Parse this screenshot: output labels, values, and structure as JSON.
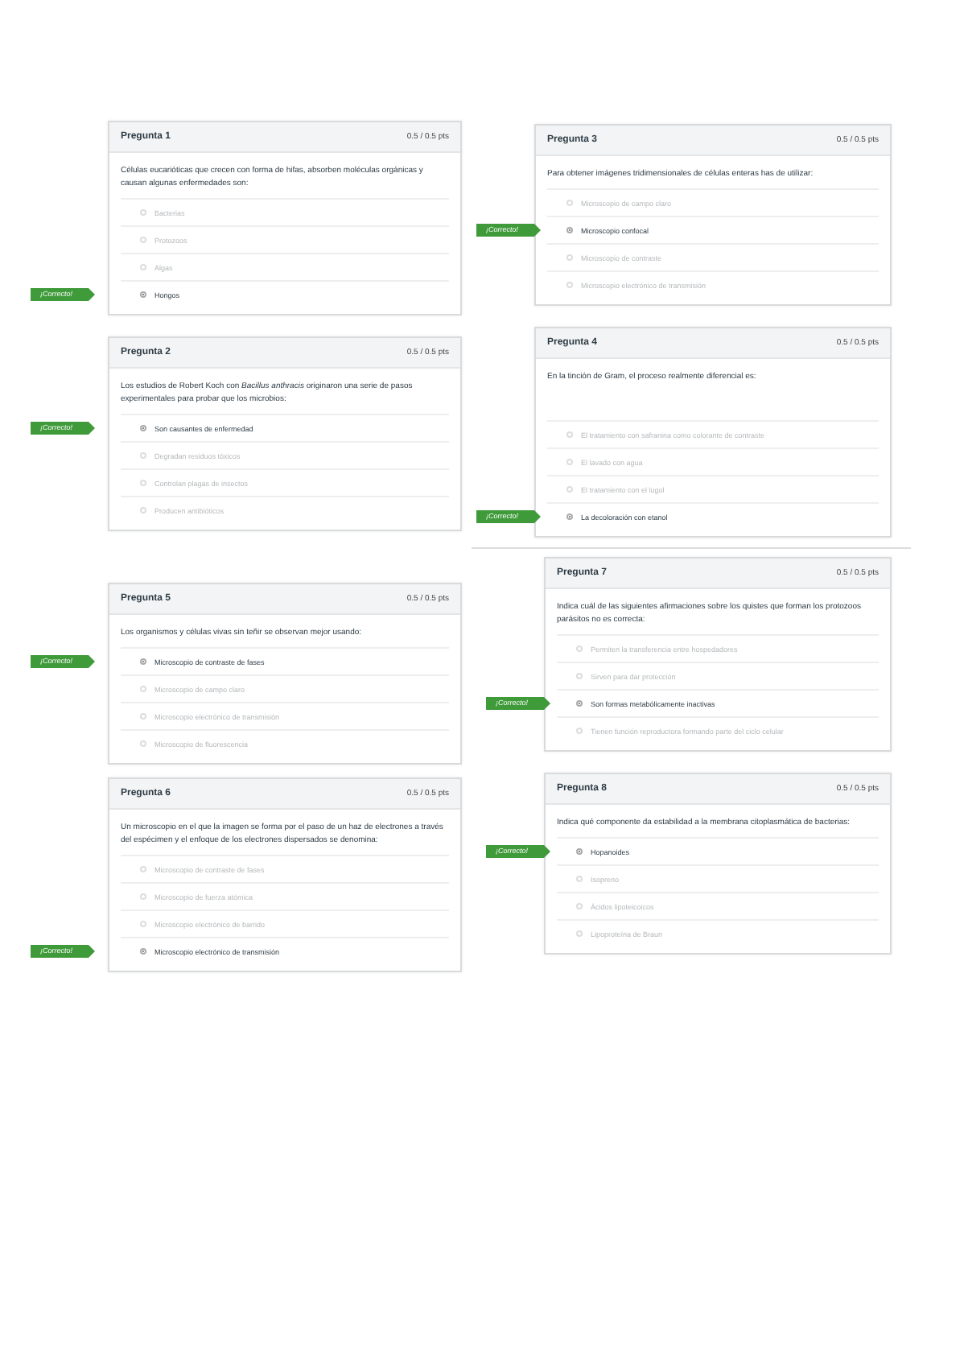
{
  "pages": [
    {
      "columns": [
        {
          "questions": [
            {
              "title": "Pregunta 1",
              "points": "0.5 / 0.5 pts",
              "text": "Células eucarióticas que crecen con forma de hifas, absorben moléculas orgánicas y causan algunas enfermedades son:",
              "answers": [
                {
                  "label": "Bacterias",
                  "selected": false
                },
                {
                  "label": "Protozoos",
                  "selected": false
                },
                {
                  "label": "Algas",
                  "selected": false
                },
                {
                  "label": "Hongos",
                  "selected": true,
                  "tag": "¡Correcto!"
                }
              ]
            },
            {
              "title": "Pregunta 2",
              "points": "0.5 / 0.5 pts",
              "text": "Los estudios de Robert Koch con *Bacillus anthracis* originaron una serie de pasos experimentales para probar que los microbios:",
              "answers": [
                {
                  "label": "Son causantes de enfermedad",
                  "selected": true,
                  "tag": "¡Correcto!"
                },
                {
                  "label": "Degradan residuos tóxicos",
                  "selected": false
                },
                {
                  "label": "Controlan plagas de insectos",
                  "selected": false
                },
                {
                  "label": "Producen antibióticos",
                  "selected": false
                }
              ]
            }
          ]
        },
        {
          "questions": [
            {
              "title": "Pregunta 3",
              "points": "0.5 / 0.5 pts",
              "text": "Para obtener imágenes tridimensionales de células enteras has de utilizar:",
              "answers": [
                {
                  "label": "Microscopio de campo claro",
                  "selected": false
                },
                {
                  "label": "Microscopio confocal",
                  "selected": true,
                  "tag": "¡Correcto!"
                },
                {
                  "label": "Microscopio de contraste",
                  "selected": false
                },
                {
                  "label": "Microscopio electrónico de transmisión",
                  "selected": false
                }
              ]
            },
            {
              "title": "Pregunta 4",
              "points": "0.5 / 0.5 pts",
              "text": "En la tinción de Gram, el proceso realmente diferencial es:",
              "answers": [
                {
                  "label": "El tratamiento con safranina como colorante de contraste",
                  "selected": false
                },
                {
                  "label": "El lavado con agua",
                  "selected": false
                },
                {
                  "label": "El tratamiento con el lugol",
                  "selected": false
                },
                {
                  "label": "La decoloración con etanol",
                  "selected": true,
                  "tag": "¡Correcto!"
                }
              ]
            }
          ]
        }
      ]
    },
    {
      "columns": [
        {
          "questions": [
            {
              "title": "Pregunta 5",
              "points": "0.5 / 0.5 pts",
              "text": "Los organismos y células vivas sin teñir se observan mejor usando:",
              "answers": [
                {
                  "label": "Microscopio de contraste de fases",
                  "selected": true,
                  "tag": "¡Correcto!"
                },
                {
                  "label": "Microscopio de campo claro",
                  "selected": false
                },
                {
                  "label": "Microscopio electrónico de transmisión",
                  "selected": false
                },
                {
                  "label": "Microscopio de fluorescencia",
                  "selected": false
                }
              ]
            },
            {
              "title": "Pregunta 6",
              "points": "0.5 / 0.5 pts",
              "text": "Un microscopio en el que la imagen se forma por el paso de un haz de electrones a través del espécimen y el enfoque de los electrones dispersados se denomina:",
              "answers": [
                {
                  "label": "Microscopio de contraste de fases",
                  "selected": false
                },
                {
                  "label": "Microscopio de fuerza atómica",
                  "selected": false
                },
                {
                  "label": "Microscopio electrónico de barrido",
                  "selected": false
                },
                {
                  "label": "Microscopio electrónico de transmisión",
                  "selected": true,
                  "tag": "¡Correcto!"
                }
              ]
            }
          ]
        },
        {
          "questions": [
            {
              "title": "Pregunta 7",
              "points": "0.5 / 0.5 pts",
              "text": "Indica cuál de las siguientes afirmaciones sobre los quistes que forman los protozoos parásitos no es correcta:",
              "answers": [
                {
                  "label": "Permiten la transferencia entre hospedadores",
                  "selected": false
                },
                {
                  "label": "Sirven para dar protección",
                  "selected": false
                },
                {
                  "label": "Son formas metabólicamente inactivas",
                  "selected": true,
                  "tag": "¡Correcto!"
                },
                {
                  "label": "Tienen función reproductora formando parte del ciclo celular",
                  "selected": false
                }
              ]
            },
            {
              "title": "Pregunta 8",
              "points": "0.5 / 0.5 pts",
              "text": "Indica qué componente da estabilidad a la membrana citoplasmática de bacterias:",
              "answers": [
                {
                  "label": "Hopanoides",
                  "selected": true,
                  "tag": "¡Correcto!"
                },
                {
                  "label": "Isopreno",
                  "selected": false
                },
                {
                  "label": "Ácidos lipoteicoicos",
                  "selected": false
                },
                {
                  "label": "Lipoproteína de Braun",
                  "selected": false
                }
              ]
            }
          ]
        }
      ]
    }
  ]
}
